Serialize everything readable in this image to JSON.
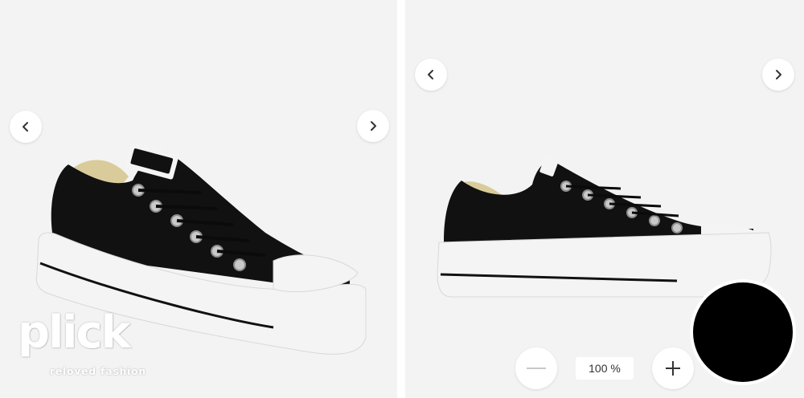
{
  "gallery_left": {
    "prev_icon": "chevron-left-icon",
    "next_icon": "chevron-right-icon"
  },
  "gallery_right": {
    "prev_icon": "chevron-left-icon",
    "next_icon": "chevron-right-icon"
  },
  "watermark": {
    "brand": "plick",
    "tagline": "reloved fashion"
  },
  "zoom": {
    "minus_icon": "minus-icon",
    "plus_icon": "plus-icon",
    "level": "100 %"
  },
  "colors": {
    "background": "#f3f3f3",
    "shoe_canvas": "#111111",
    "sole": "#f4f4f4",
    "overlay": "#000000"
  }
}
